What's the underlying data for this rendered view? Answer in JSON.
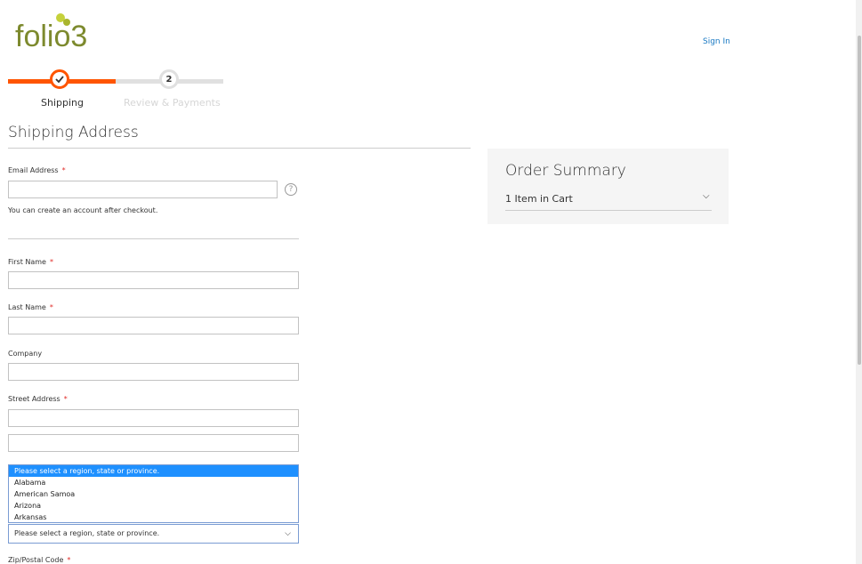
{
  "header": {
    "logo_text": "folio3",
    "signin_label": "Sign In"
  },
  "progress": {
    "steps": [
      {
        "number": "✓",
        "label": "Shipping",
        "state": "active"
      },
      {
        "number": "2",
        "label": "Review & Payments",
        "state": "inactive"
      }
    ]
  },
  "shipping": {
    "title": "Shipping Address",
    "email": {
      "label": "Email Address",
      "required": "*",
      "value": "",
      "help_icon": "?"
    },
    "note": "You can create an account after checkout.",
    "first_name": {
      "label": "First Name",
      "required": "*",
      "value": ""
    },
    "last_name": {
      "label": "Last Name",
      "required": "*",
      "value": ""
    },
    "company": {
      "label": "Company",
      "value": ""
    },
    "street": {
      "label": "Street Address",
      "required": "*",
      "line1": "",
      "line2": ""
    },
    "region": {
      "selected": "Please select a region, state or province.",
      "options": [
        "Please select a region, state or province.",
        "Alabama",
        "American Samoa",
        "Arizona",
        "Arkansas"
      ]
    },
    "zip": {
      "label": "Zip/Postal Code",
      "required": "*"
    }
  },
  "summary": {
    "title": "Order Summary",
    "items": "1 Item in Cart"
  },
  "colors": {
    "accent": "#ff5501",
    "link": "#1979c3",
    "required": "#e02b27",
    "selection": "#1e90ff"
  }
}
